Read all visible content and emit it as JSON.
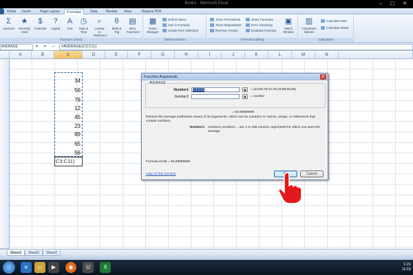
{
  "window": {
    "title": "Book1 - Microsoft Excel",
    "controls": "– ▢ ✕"
  },
  "tabs": [
    "Home",
    "Insert",
    "Page Layout",
    "Formulas",
    "Data",
    "Review",
    "View",
    "Nuance PDF"
  ],
  "active_tab": "Formulas",
  "ribbon": {
    "function_library": {
      "label": "Function Library",
      "buttons": [
        {
          "label": "AutoSum",
          "icon": "Σ"
        },
        {
          "label": "Recently Used",
          "icon": "★"
        },
        {
          "label": "Financial",
          "icon": "$"
        },
        {
          "label": "Logical",
          "icon": "?"
        },
        {
          "label": "Text",
          "icon": "A"
        },
        {
          "label": "Date & Time",
          "icon": "◷"
        },
        {
          "label": "Lookup & Reference",
          "icon": "⌕"
        },
        {
          "label": "Math & Trig",
          "icon": "θ"
        },
        {
          "label": "More Functions",
          "icon": "▤"
        }
      ]
    },
    "defined_names": {
      "label": "Defined Names",
      "name_manager": "Name Manager",
      "items": [
        "Define Name",
        "Use in Formula",
        "Create from Selection"
      ]
    },
    "formula_auditing": {
      "label": "Formula Auditing",
      "left": [
        "Trace Precedents",
        "Trace Dependents",
        "Remove Arrows"
      ],
      "right": [
        "Show Formulas",
        "Error Checking",
        "Evaluate Formula"
      ],
      "watch_window": "Watch Window"
    },
    "calculation": {
      "label": "Calculation",
      "options": "Calculation Options",
      "items": [
        "Calculate Now",
        "Calculate Sheet"
      ]
    }
  },
  "formula_bar": {
    "name_box": "AVERAGE",
    "buttons": "▾ ✕ ✓ fx",
    "formula": "=AVERAGE(C3:C11)"
  },
  "columns": [
    "A",
    "B",
    "C",
    "D",
    "E",
    "F",
    "G",
    "H",
    "I",
    "J",
    "K",
    "L",
    "M",
    "N"
  ],
  "selected_column": "C",
  "cells": [
    "34",
    "56",
    "78",
    "12",
    "45",
    "23",
    "89",
    "65",
    "56"
  ],
  "editing_cell": "C3:C11)",
  "dialog": {
    "title": "Function Arguments",
    "function_name": "AVERAGE",
    "arg1_label": "Number1",
    "arg1_value": "C3:C11",
    "arg1_result": "= {34;56;78;12;45;23;89;65;56}",
    "arg2_label": "Number2",
    "arg2_result": "= number",
    "total_result": "= 50.88888889",
    "description": "Returns the average (arithmetic mean) of its arguments, which can be numbers or names, arrays, or references that contain numbers.",
    "arg_help_label": "Number1:",
    "arg_help": "number1,number2,... are 1 to 255 numeric arguments for which you want the average.",
    "formula_result": "Formula result =  50.88888889",
    "help_link": "Help on this function",
    "ok_label": "OK",
    "cancel_label": "Cancel"
  },
  "sheets": [
    "Sheet1",
    "Sheet2",
    "Sheet3"
  ],
  "active_sheet": "Sheet1",
  "taskbar": {
    "clock_time": "1:21",
    "clock_date": "11/10"
  }
}
